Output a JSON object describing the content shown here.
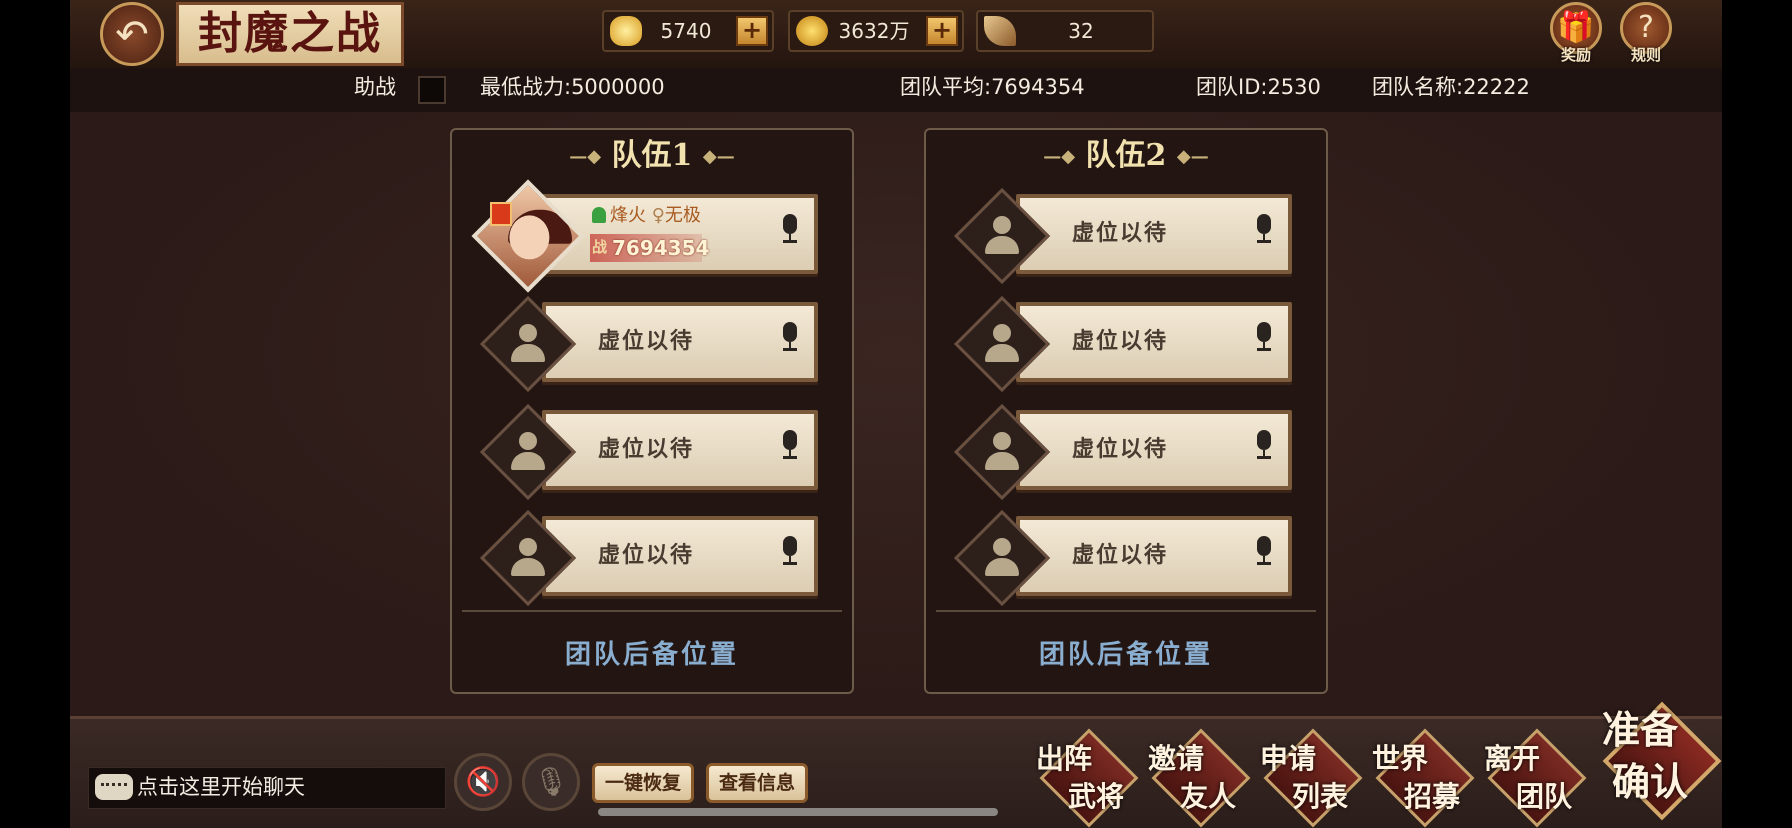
{
  "header": {
    "title": "封魔之战",
    "resources": [
      {
        "icon": "gold-ingot-icon",
        "value": "5740",
        "has_plus": true
      },
      {
        "icon": "gold-coin-icon",
        "value": "3632万",
        "has_plus": true
      },
      {
        "icon": "feather-quill-icon",
        "value": "32",
        "has_plus": false
      }
    ],
    "reward_label": "奖励",
    "rules_label": "规则"
  },
  "info": {
    "assist_label": "助战",
    "min_power": "最低战力:5000000",
    "team_avg": "团队平均:7694354",
    "team_id": "团队ID:2530",
    "team_name": "团队名称:22222"
  },
  "teams": [
    {
      "title": "队伍1",
      "player": {
        "name": "烽火",
        "title": "无极",
        "power_label": "战",
        "power": "7694354"
      },
      "empty_label": "虚位以待",
      "reserve": "团队后备位置"
    },
    {
      "title": "队伍2",
      "empty_label": "虚位以待",
      "reserve": "团队后备位置"
    }
  ],
  "bottom": {
    "chat_placeholder": "点击这里开始聊天",
    "restore": "一键恢复",
    "view_info": "查看信息",
    "actions": [
      {
        "l1": "出阵",
        "l2": "武将"
      },
      {
        "l1": "邀请",
        "l2": "友人"
      },
      {
        "l1": "申请",
        "l2": "列表"
      },
      {
        "l1": "世界",
        "l2": "招募"
      },
      {
        "l1": "离开",
        "l2": "团队"
      }
    ],
    "ready": {
      "l1": "准备",
      "l2": "确认"
    }
  },
  "colors": {
    "accent": "#c89a5a",
    "background": "#2a1a17",
    "reserve_text": "#8aaed0"
  }
}
